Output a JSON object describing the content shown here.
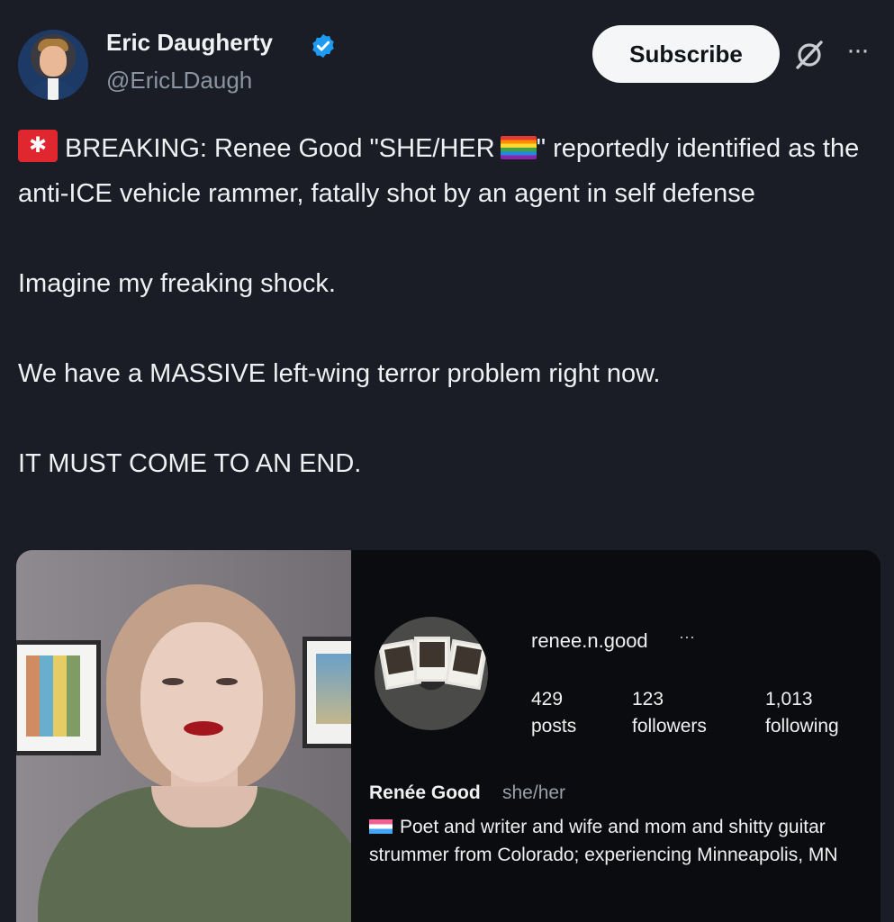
{
  "author": {
    "display_name": "Eric Daugherty",
    "handle": "@EricLDaugh",
    "verified": true,
    "verified_icon": "verified-badge-icon"
  },
  "actions": {
    "subscribe_label": "Subscribe",
    "grok_icon": "grok-icon",
    "more_icon": "more-options-icon"
  },
  "tweet": {
    "line1_prefix": "BREAKING: Renee Good \"SHE/HER",
    "line1_suffix": "\" reportedly identified as the anti-ICE vehicle rammer, fatally shot by an agent in self defense",
    "line2": "Imagine my freaking shock.",
    "line3": "We have a MASSIVE left-wing terror problem right now.",
    "line4": "IT MUST COME TO AN END.",
    "emoji_siren": "siren-icon",
    "emoji_flag": "rainbow-flag-icon"
  },
  "embed": {
    "username": "renee.n.good",
    "username_more": "···",
    "stats": [
      {
        "value": "429",
        "label": "posts"
      },
      {
        "value": "123",
        "label": "followers"
      },
      {
        "value": "1,013",
        "label": "following"
      }
    ],
    "full_name": "Renée Good",
    "pronouns": "she/her",
    "bio": "Poet and writer and wife and mom and shitty guitar strummer from Colorado; experiencing Minneapolis, MN",
    "bio_flag": "trans-flag-icon"
  },
  "colors": {
    "background": "#1a1d26",
    "verified_blue": "#1d9bf0",
    "subscribe_bg": "#f5f6f7"
  }
}
